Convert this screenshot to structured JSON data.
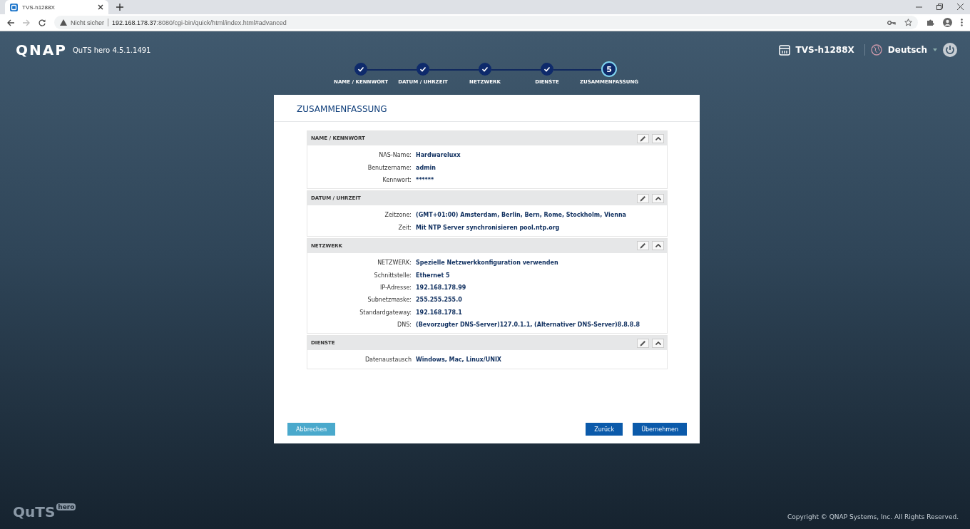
{
  "browser": {
    "tab_title": "TVS-h1288X",
    "security": "Nicht sicher",
    "url_host": "192.168.178.37",
    "url_rest": ":8080/cgi-bin/quick/html/index.html#advanced"
  },
  "header": {
    "logo": "QNAP",
    "version": "QuTS hero 4.5.1.1491",
    "device": "TVS-h1288X",
    "language": "Deutsch"
  },
  "steps": [
    {
      "label": "NAME / KENNWORT",
      "completed": true
    },
    {
      "label": "DATUM / UHRZEIT",
      "completed": true
    },
    {
      "label": "NETZWERK",
      "completed": true
    },
    {
      "label": "DIENSTE",
      "completed": true
    },
    {
      "label": "ZUSAMMENFASSUNG",
      "completed": false,
      "number": "5"
    }
  ],
  "dialog": {
    "title": "ZUSAMMENFASSUNG",
    "sections": [
      {
        "title": "NAME / KENNWORT",
        "expanded": true,
        "rows": [
          {
            "label": "NAS-Name:",
            "value": "Hardwareluxx"
          },
          {
            "label": "Benutzername:",
            "value": "admin"
          },
          {
            "label": "Kennwort:",
            "value": "******"
          }
        ]
      },
      {
        "title": "DATUM / UHRZEIT",
        "expanded": true,
        "rows": [
          {
            "label": "Zeitzone:",
            "value": "(GMT+01:00) Amsterdam, Berlin, Bern, Rome, Stockholm, Vienna"
          },
          {
            "label": "Zeit:",
            "value": "Mit NTP Server synchronisieren pool.ntp.org"
          }
        ]
      },
      {
        "title": "NETZWERK",
        "expanded": true,
        "rows": [
          {
            "label": "NETZWERK:",
            "value": "Spezielle Netzwerkkonfiguration verwenden"
          },
          {
            "label": "Schnittstelle:",
            "value": "Ethernet 5"
          },
          {
            "label": "IP-Adresse:",
            "value": "192.168.178.99"
          },
          {
            "label": "Subnetzmaske:",
            "value": "255.255.255.0"
          },
          {
            "label": "Standardgateway:",
            "value": "192.168.178.1"
          },
          {
            "label": "DNS:",
            "value": "(Bevorzugter DNS-Server)127.0.1.1, (Alternativer DNS-Server)8.8.8.8"
          }
        ]
      },
      {
        "title": "DIENSTE",
        "expanded": true,
        "rows": [
          {
            "label": "Datenaustausch",
            "value": "Windows, Mac, Linux/UNIX"
          }
        ]
      }
    ],
    "buttons": [
      {
        "label": "Abbrechen",
        "kind": "secondary"
      },
      {
        "label": "Zurück",
        "kind": "primary"
      },
      {
        "label": "Übernehmen",
        "kind": "primary"
      }
    ]
  },
  "footer": {
    "logo": "QuTS",
    "logo_badge": "hero",
    "copyright": "Copyright © QNAP Systems, Inc. All Rights Reserved."
  }
}
